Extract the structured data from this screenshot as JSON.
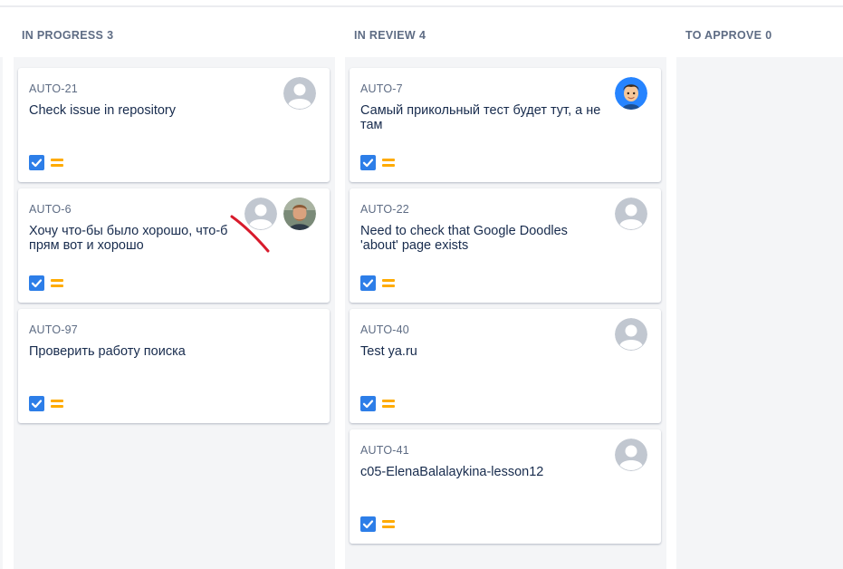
{
  "columns": [
    {
      "title": "IN PROGRESS",
      "count": "3"
    },
    {
      "title": "IN REVIEW",
      "count": "4"
    },
    {
      "title": "TO APPROVE",
      "count": "0"
    }
  ],
  "cards": {
    "c1": {
      "key": "AUTO-21",
      "summary": "Check issue in repository",
      "avatar": "default-user-icon"
    },
    "c2": {
      "key": "AUTO-6",
      "summary": "Хочу что-бы было хорошо, что-б",
      "summary2": "прям вот и хорошо",
      "avatar": "default-user-icon",
      "avatar2": "user-photo"
    },
    "c3": {
      "key": "AUTO-97",
      "summary": "Проверить работу поиска",
      "avatar": ""
    },
    "c4": {
      "key": "AUTO-7",
      "summary": "Самый прикольный тест будет тут, а не",
      "summary2": "там",
      "avatar": "cartoon-user-avatar"
    },
    "c5": {
      "key": "AUTO-22",
      "summary": "Need to check that Google Doodles",
      "summary2": "'about' page exists",
      "avatar": "default-user-icon"
    },
    "c6": {
      "key": "AUTO-40",
      "summary": "Test ya.ru",
      "avatar": "default-user-icon"
    },
    "c7": {
      "key": "AUTO-41",
      "summary": "c05-ElenaBalalaykina-lesson12",
      "avatar": "default-user-icon"
    }
  },
  "icons": {
    "checkbox": "checkbox-checked-icon",
    "priority": "priority-medium-icon"
  },
  "colors": {
    "checkbox": "#2d7ee8",
    "priority": "#ffab00",
    "column_bg": "#f4f5f7",
    "header_text": "#5e6c84"
  }
}
